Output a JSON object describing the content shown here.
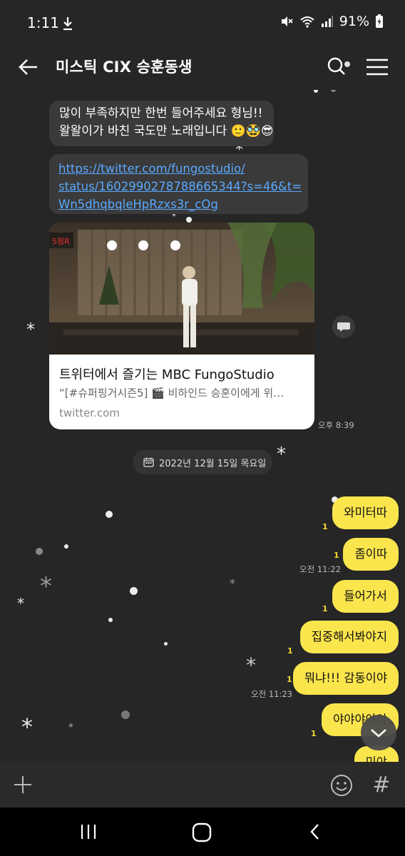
{
  "status_bar": {
    "time": "1:11",
    "battery": "91%"
  },
  "header": {
    "title": "미스틱 CIX 승훈동생"
  },
  "messages_in": {
    "text_line1": "많이 부족하지만 한번 들어주세요 형님!!",
    "text_line2": "왈왈이가 바친 국도만 노래입니다 🙂🥸😎",
    "link_line1": "https://twitter.com/fungostudio/",
    "link_line2": "status/1602990278788665344?s=46&t=",
    "link_line3": "Wn5dhqbqleHpRzxs3r_cOg",
    "card_title": "트위터에서 즐기는 MBC FungoStudio",
    "card_desc": "“[#슈퍼핑거시즌5] 🎬 비하인드 승훈이에게 위…",
    "card_domain": "twitter.com",
    "time": "오후 8:39"
  },
  "date_separator": "2022년 12월 15일 목요일",
  "messages_out": [
    {
      "text": "와미터따",
      "unread": "1"
    },
    {
      "text": "좀이따",
      "unread": "1",
      "time": "오전 11:22"
    },
    {
      "text": "들어가서",
      "unread": "1"
    },
    {
      "text": "집중해서봐야지",
      "unread": "1"
    },
    {
      "text": "뭐냐!!! 감동이야",
      "unread": "1",
      "time": "오전 11:23"
    },
    {
      "text": "야야야야야",
      "unread": "1"
    },
    {
      "text": "미야",
      "unread": ""
    }
  ],
  "input": {
    "placeholder": ""
  },
  "icons": {
    "back": "back-arrow-icon",
    "search": "search-icon",
    "menu": "hamburger-menu-icon",
    "share": "chat-share-icon",
    "calendar": "calendar-icon",
    "scroll_down": "chevron-down-icon",
    "plus": "plus-icon",
    "emoji": "emoji-icon",
    "hash": "hash-icon"
  },
  "colors": {
    "background": "#262626",
    "bubble_out": "#fbe54d",
    "bubble_in": "#3a3a3a",
    "unread": "#f5d838",
    "link": "#5aa9ff"
  }
}
